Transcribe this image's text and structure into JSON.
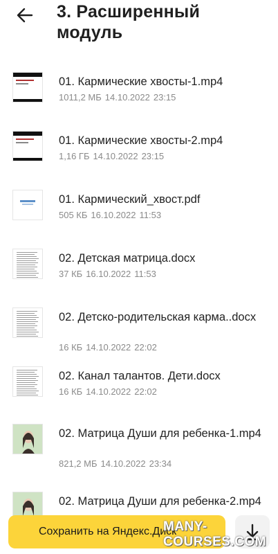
{
  "header": {
    "title": "3. Расширенный модуль",
    "back_icon": "arrow-left-icon"
  },
  "files": [
    {
      "name": "01. Кармические хвосты-1.mp4",
      "size": "1011,2 МБ",
      "date": "14.10.2022",
      "time": "23:15",
      "thumb": "video-slide"
    },
    {
      "name": "01. Кармические хвосты-2.mp4",
      "size": "1,16 ГБ",
      "date": "14.10.2022",
      "time": "23:15",
      "thumb": "video-slide"
    },
    {
      "name": "01. Кармический_хвост.pdf",
      "size": "505 КБ",
      "date": "16.10.2022",
      "time": "11:53",
      "thumb": "pdf"
    },
    {
      "name": "02. Детская матрица.docx",
      "size": "37 КБ",
      "date": "16.10.2022",
      "time": "11:53",
      "thumb": "doc"
    },
    {
      "name": "02. Детско-родительская карма..docx",
      "size": "16 КБ",
      "date": "14.10.2022",
      "time": "22:02",
      "thumb": "doc"
    },
    {
      "name": "02. Канал талантов. Дети.docx",
      "size": "16 КБ",
      "date": "14.10.2022",
      "time": "22:02",
      "thumb": "doc"
    },
    {
      "name": "02. Матрица Души для ребенка-1.mp4",
      "size": "821,2 МБ",
      "date": "14.10.2022",
      "time": "23:34",
      "thumb": "video-person"
    },
    {
      "name": "02. Матрица Души для ребенка-2.mp4",
      "size": "",
      "date": "",
      "time": "",
      "thumb": "video-person"
    }
  ],
  "bottom": {
    "save_label": "Сохранить на Яндекс.Диск",
    "download_icon": "download-icon",
    "watermark": "MANY-COURSES.COM"
  },
  "colors": {
    "accent": "#fcd43a",
    "meta_text": "#8a8a8a"
  }
}
